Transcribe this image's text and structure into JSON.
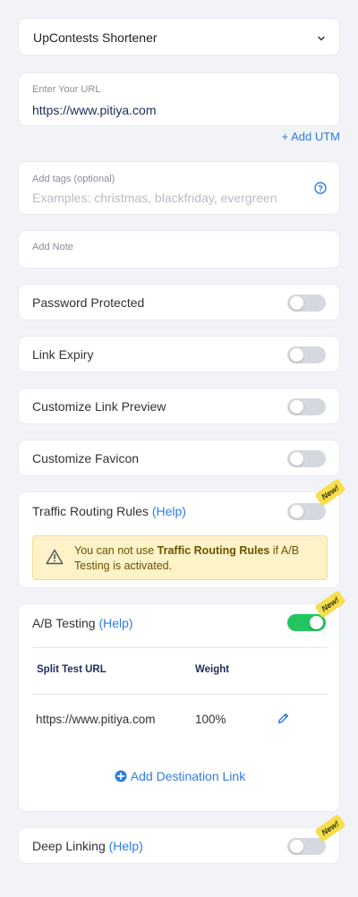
{
  "shortener": {
    "selected": "UpContests Shortener"
  },
  "url_field": {
    "label": "Enter Your URL",
    "value": "https://www.pitiya.com"
  },
  "add_utm": "+ Add UTM",
  "tags_field": {
    "label": "Add tags (optional)",
    "placeholder": "Examples: christmas, blackfriday, evergreen"
  },
  "note_field": {
    "placeholder": "Add Note"
  },
  "toggles": {
    "password": {
      "label": "Password Protected",
      "on": false
    },
    "expiry": {
      "label": "Link Expiry",
      "on": false
    },
    "preview": {
      "label": "Customize Link Preview",
      "on": false
    },
    "favicon": {
      "label": "Customize Favicon",
      "on": false
    }
  },
  "traffic": {
    "label": "Traffic Routing Rules",
    "help": "(Help)",
    "badge": "New!",
    "on": false,
    "warning": {
      "prefix": "You can not use ",
      "bold": "Traffic Routing Rules",
      "suffix": " if A/B Testing is activated."
    }
  },
  "ab_testing": {
    "label": "A/B Testing",
    "help": "(Help)",
    "badge": "New!",
    "on": true,
    "columns": {
      "url": "Split Test URL",
      "weight": "Weight"
    },
    "rows": [
      {
        "url": "https://www.pitiya.com",
        "weight": "100%"
      }
    ],
    "add_label": "Add Destination Link"
  },
  "deep_linking": {
    "label": "Deep Linking",
    "help": "(Help)",
    "badge": "New!",
    "on": false
  },
  "colors": {
    "accent": "#2f7de1",
    "toggle_on": "#22c55e",
    "toggle_off": "#d5d8df",
    "badge": "#f5df4d",
    "warning_bg": "#fdf2c8"
  }
}
